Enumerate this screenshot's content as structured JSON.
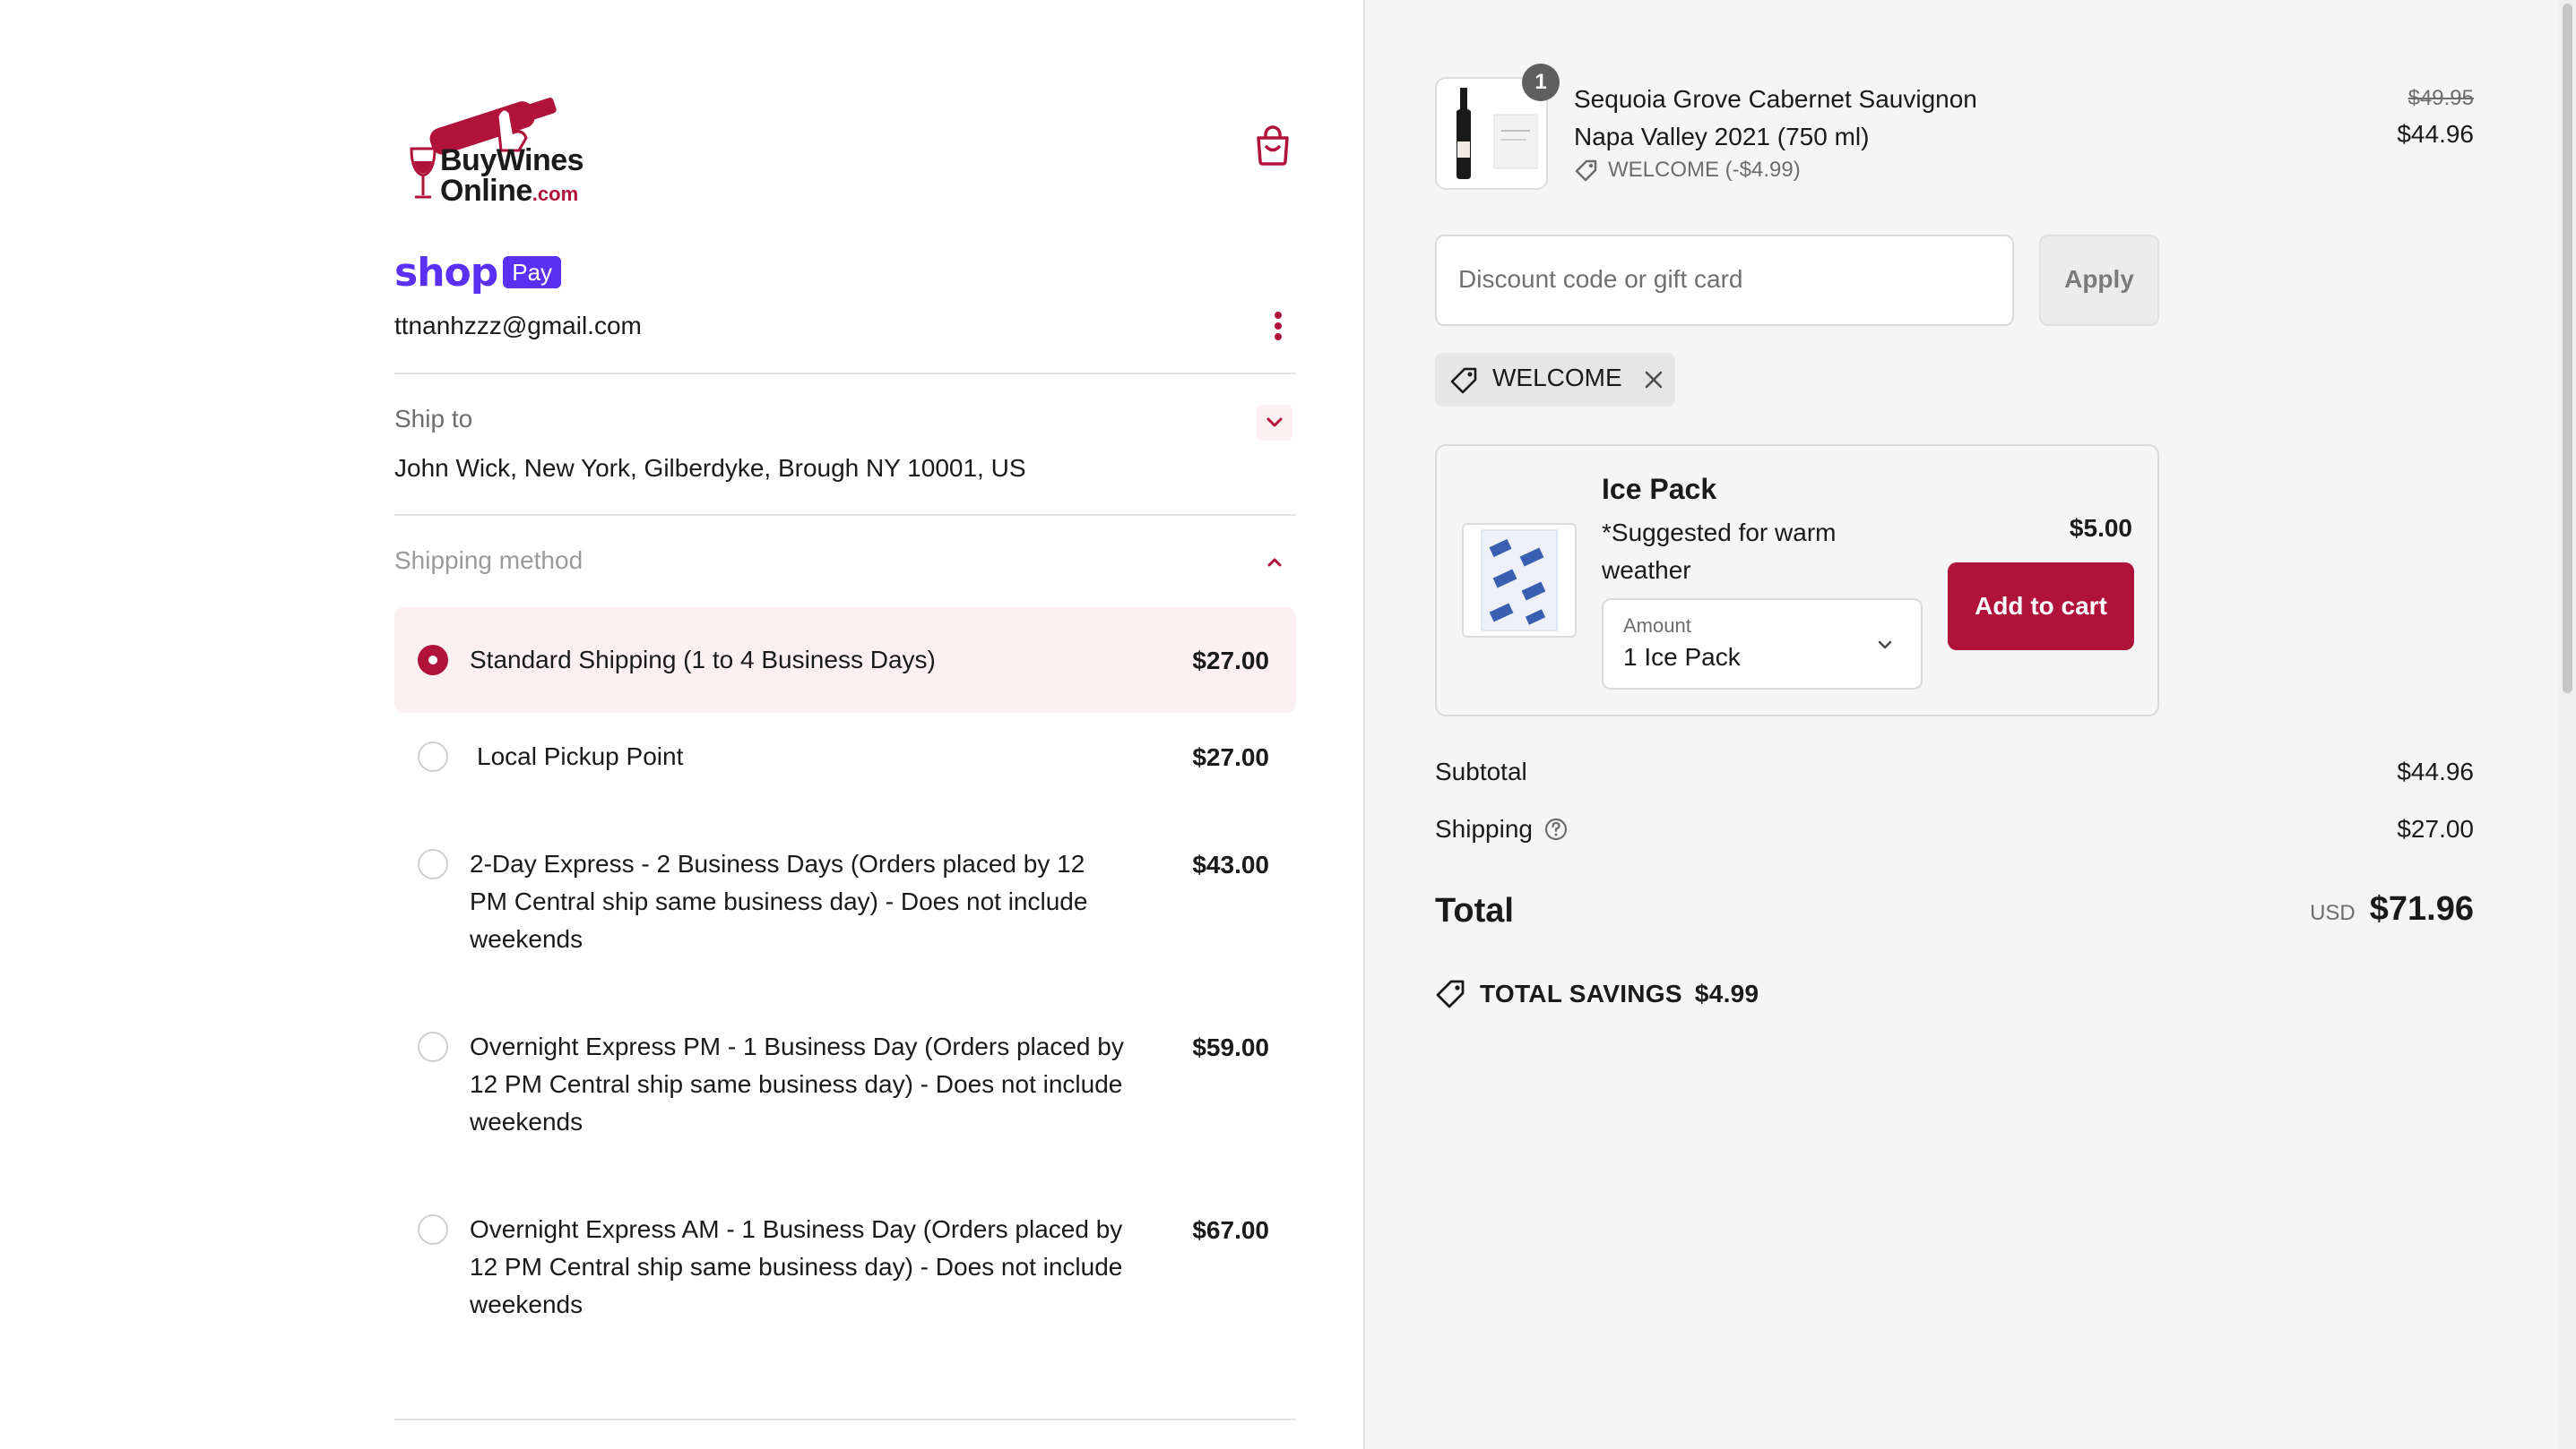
{
  "brand": {
    "logo_line1": "BuyWines",
    "logo_line2": "Online",
    "logo_suffix": ".com",
    "accent_color": "#b0123a"
  },
  "header": {
    "cart_icon": "shopping-bag-icon"
  },
  "shop_pay": {
    "word": "shop",
    "badge": "Pay",
    "color": "#5a31f4"
  },
  "account": {
    "email": "ttnanhzzz@gmail.com",
    "menu_icon": "more-vertical-icon"
  },
  "ship_to": {
    "label": "Ship to",
    "address": "John Wick, New York, Gilberdyke, Brough NY 10001, US",
    "toggle_icon": "chevron-down-icon"
  },
  "shipping_method": {
    "label": "Shipping method",
    "toggle_icon": "chevron-up-icon",
    "options": [
      {
        "name": "Standard Shipping (1 to 4 Business Days)",
        "price": "$27.00",
        "selected": true
      },
      {
        "name": "Local Pickup Point",
        "price": "$27.00",
        "selected": false
      },
      {
        "name_lines": [
          "2-Day Express - 2 Business Days (Orders placed by 12",
          "PM Central ship same business day) - Does not include",
          "weekends"
        ],
        "price": "$43.00",
        "selected": false
      },
      {
        "name_lines": [
          "Overnight Express PM - 1 Business Day (Orders placed by",
          "12 PM Central ship same business day) - Does not include",
          "weekends"
        ],
        "price": "$59.00",
        "selected": false
      },
      {
        "name_lines": [
          "Overnight Express AM - 1 Business Day (Orders placed by",
          "12 PM Central ship same business day) - Does not include",
          "weekends"
        ],
        "price": "$67.00",
        "selected": false
      }
    ]
  },
  "order": {
    "item": {
      "quantity": "1",
      "name_line1": "Sequoia Grove Cabernet Sauvignon",
      "name_line2": "Napa Valley 2021 (750 ml)",
      "discount": "WELCOME (-$4.99)",
      "original_price": "$49.95",
      "price": "$44.96"
    },
    "discount_input": {
      "placeholder": "Discount code or gift card",
      "apply_label": "Apply"
    },
    "applied_code": "WELCOME",
    "upsell": {
      "title": "Ice Pack",
      "desc_line1": "*Suggested for warm",
      "desc_line2": "weather",
      "price": "$5.00",
      "amount_label": "Amount",
      "amount_value": "1 Ice Pack",
      "button": "Add to cart"
    },
    "summary": {
      "subtotal_label": "Subtotal",
      "subtotal": "$44.96",
      "shipping_label": "Shipping",
      "shipping": "$27.00",
      "total_label": "Total",
      "currency": "USD",
      "total": "$71.96",
      "savings_label": "TOTAL SAVINGS",
      "savings": "$4.99"
    }
  }
}
